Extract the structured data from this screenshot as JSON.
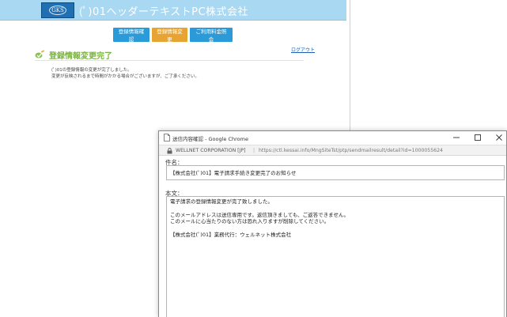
{
  "site": {
    "logo_text": "GKS",
    "title": "(ﾟ)01ヘッダーテキストPC株式会社",
    "nav": [
      {
        "label": "登録情報確認"
      },
      {
        "label": "登録情報変更"
      },
      {
        "label": "ご利用料金照会"
      }
    ],
    "logout": "ログアウト",
    "section_title": "登録情報変更完了",
    "messages": [
      "(ﾟ)01の登録情報の変更が完了しました。",
      "変更が反映されるまで時間がかかる場合がございますが、ご了承ください。"
    ]
  },
  "popup": {
    "window_title": "送信内容確認 - Google Chrome",
    "site_name": "WELLNET CORPORATION [JP]",
    "separator": "|",
    "url": "https://ctl.kessai.info/MngSiteTst/ptp/sendmailresult/detail?id=1000055624",
    "subject_label": "件名：",
    "subject": "【株式会社(ﾟ)01】電子請求手続き変更完了のお知らせ",
    "body_label": "本文：",
    "body_lines": [
      "電子請求の登録情報変更が完了致しました。",
      "",
      "このメールアドレスは送信専用です。返信頂きましても、ご返答できません。",
      "このメールに心当たりのない方は恐れ入りますが削除してください。",
      "",
      "【株式会社(ﾟ)01】業務代行：ウェルネット株式会社"
    ]
  },
  "colors": {
    "header_bg": "#a9d8f2",
    "nav_blue": "#2b9ad8",
    "nav_orange": "#e7a432",
    "section_title": "#7bb342"
  }
}
